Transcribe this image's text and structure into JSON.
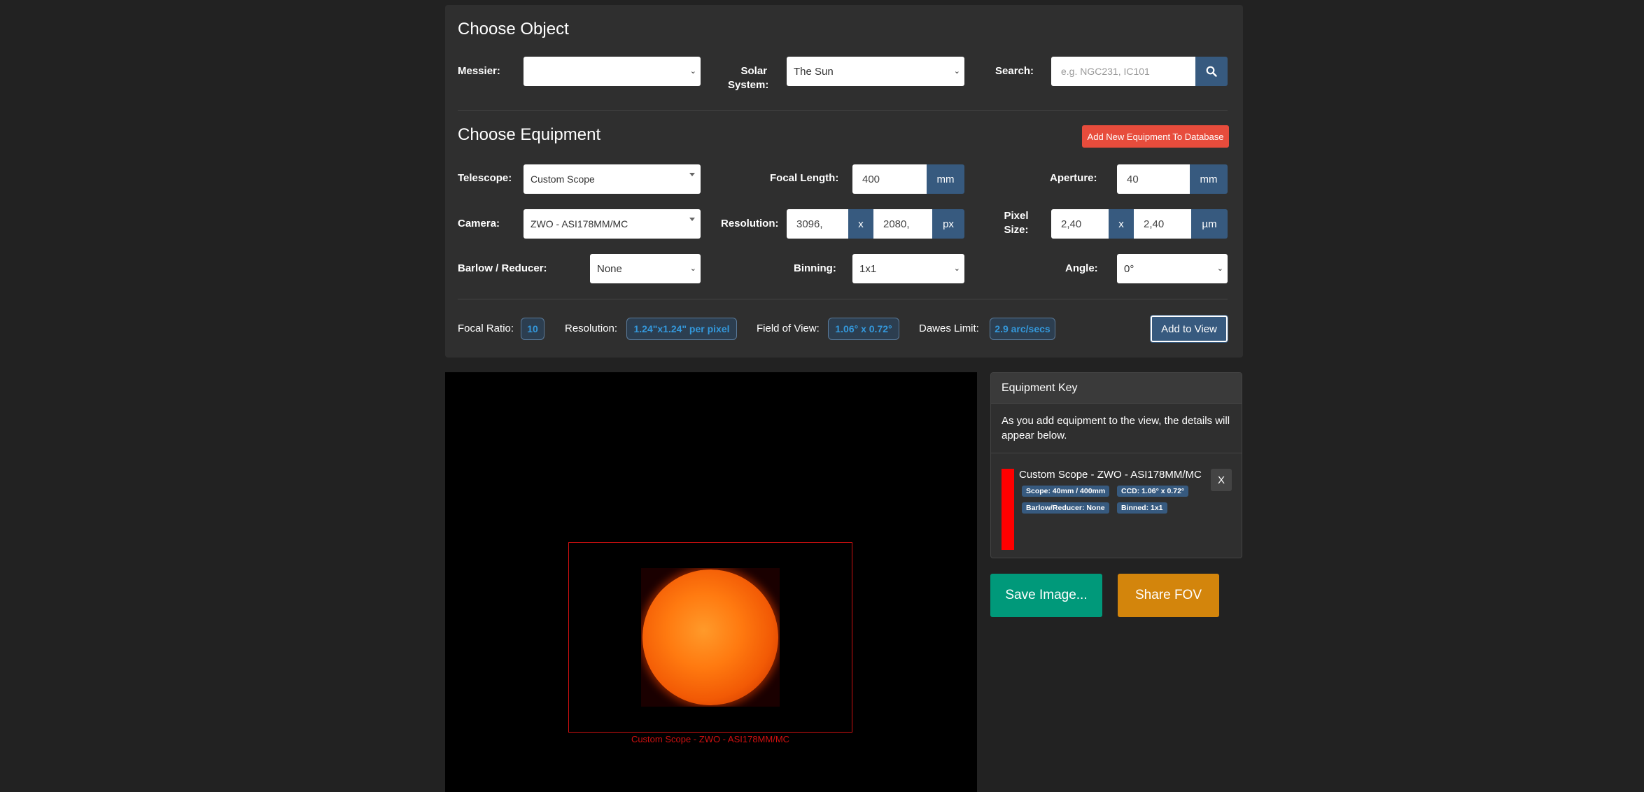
{
  "object": {
    "title": "Choose Object",
    "messier_label": "Messier:",
    "messier_value": "",
    "solar_label": "Solar System:",
    "solar_value": "The Sun",
    "search_label": "Search:",
    "search_placeholder": "e.g. NGC231, IC101"
  },
  "equipment": {
    "title": "Choose Equipment",
    "add_new_label": "Add New Equipment To Database",
    "telescope_label": "Telescope:",
    "telescope_value": "Custom Scope",
    "focal_length_label": "Focal Length:",
    "focal_length_value": "400",
    "focal_length_unit": "mm",
    "aperture_label": "Aperture:",
    "aperture_value": "40",
    "aperture_unit": "mm",
    "camera_label": "Camera:",
    "camera_value": "ZWO - ASI178MM/MC",
    "resolution_label": "Resolution:",
    "resolution_w": "3096,",
    "resolution_x": "x",
    "resolution_h": "2080,",
    "resolution_unit": "px",
    "pixel_size_label": "Pixel Size:",
    "pixel_w": "2,40",
    "pixel_x": "x",
    "pixel_h": "2,40",
    "pixel_unit": "µm",
    "barlow_label": "Barlow / Reducer:",
    "barlow_value": "None",
    "binning_label": "Binning:",
    "binning_value": "1x1",
    "angle_label": "Angle:",
    "angle_value": "0°"
  },
  "stats": {
    "focal_ratio_label": "Focal Ratio:",
    "focal_ratio_value": "10",
    "resolution_label": "Resolution:",
    "resolution_value": "1.24\"x1.24\" per pixel",
    "fov_label": "Field of View:",
    "fov_value": "1.06° x 0.72°",
    "dawes_label": "Dawes Limit:",
    "dawes_value": "2.9 arc/secs",
    "add_view_label": "Add to View"
  },
  "view": {
    "fov_caption": "Custom Scope - ZWO - ASI178MM/MC"
  },
  "key": {
    "title": "Equipment Key",
    "description": "As you add equipment to the view, the details will appear below.",
    "item": {
      "title": "Custom Scope - ZWO - ASI178MM/MC",
      "scope": "Scope: 40mm / 400mm",
      "ccd": "CCD: 1.06° x 0.72°",
      "barlow": "Barlow/Reducer: None",
      "binned": "Binned: 1x1",
      "remove": "X",
      "color": "#ff0000"
    }
  },
  "actions": {
    "save_label": "Save Image...",
    "share_label": "Share FOV"
  },
  "icons": {
    "search": "search-icon",
    "remove": "close-icon"
  }
}
